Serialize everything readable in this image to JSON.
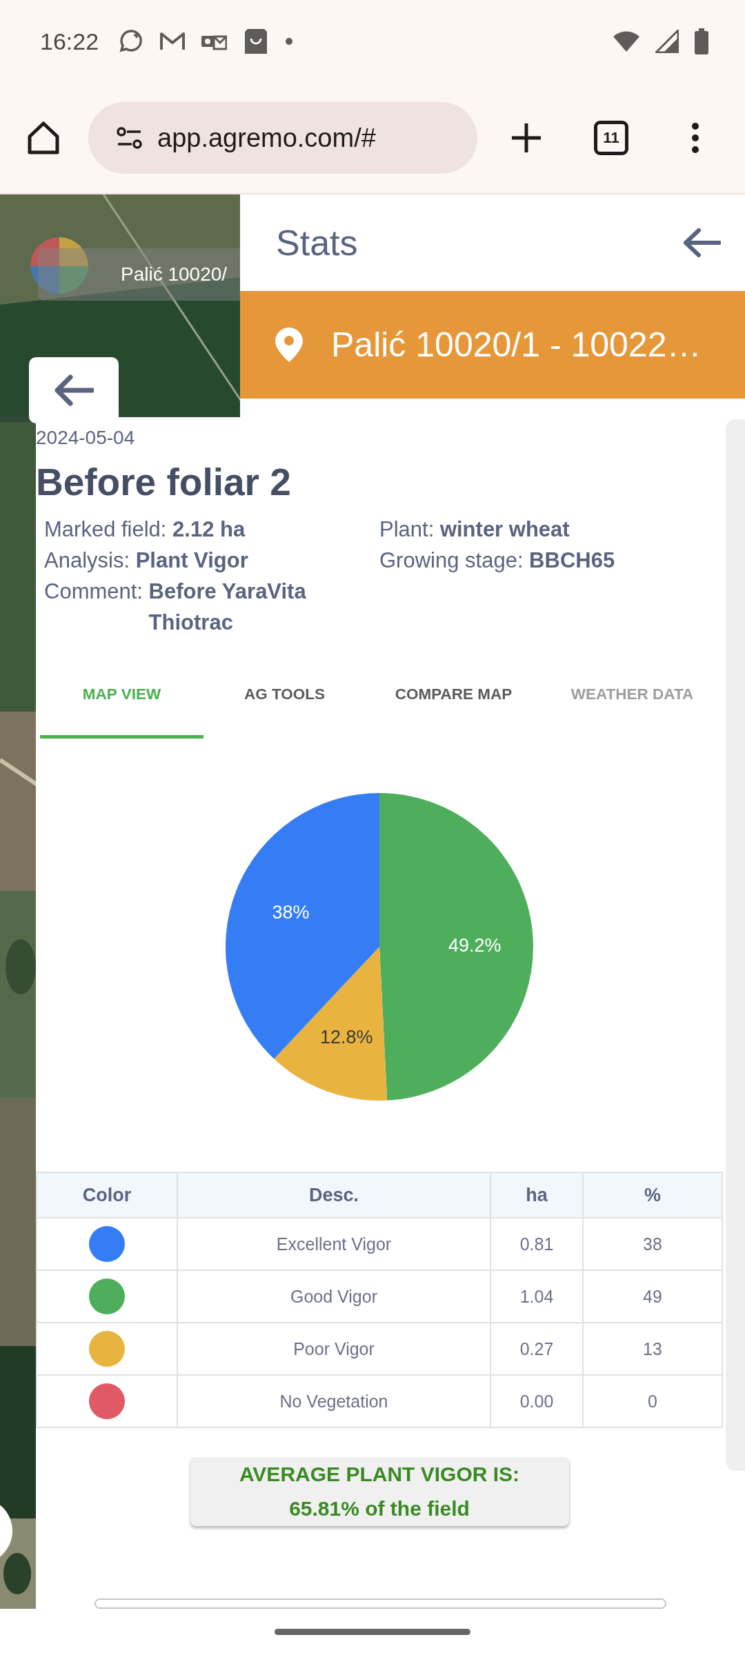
{
  "status_bar": {
    "time": "16:22"
  },
  "browser": {
    "url": "app.agremo.com/#",
    "tab_count": "11"
  },
  "map": {
    "field_label": "Palić 10020/"
  },
  "stats_panel": {
    "title": "Stats",
    "location": "Palić 10020/1 - 10022…"
  },
  "analysis": {
    "date": "2024-05-04",
    "title": "Before foliar 2",
    "details": [
      {
        "label": "Marked field: ",
        "value": "2.12 ha"
      },
      {
        "label": "Plant: ",
        "value": "winter wheat"
      },
      {
        "label": "Analysis: ",
        "value": "Plant Vigor"
      },
      {
        "label": "Growing stage: ",
        "value": "BBCH65"
      },
      {
        "label": "Comment: ",
        "value": "Before YaraVita Thiotrac"
      }
    ]
  },
  "tabs": [
    {
      "label": "MAP VIEW",
      "selected": true,
      "disabled": false
    },
    {
      "label": "AG TOOLS",
      "selected": false,
      "disabled": false
    },
    {
      "label": "COMPARE MAP",
      "selected": false,
      "disabled": false
    },
    {
      "label": "WEATHER DATA",
      "selected": false,
      "disabled": true
    }
  ],
  "chart_data": {
    "type": "pie",
    "values": [
      49.2,
      12.8,
      38
    ],
    "colors": [
      "#4fae5c",
      "#e8b43f",
      "#357df5"
    ],
    "value_labels": [
      "49.2%",
      "12.8%",
      "38%"
    ]
  },
  "table": {
    "columns": [
      "Color",
      "Desc.",
      "ha",
      "%"
    ],
    "rows": [
      {
        "color": "#357df5",
        "desc": "Excellent Vigor",
        "ha": "0.81",
        "percent": "38"
      },
      {
        "color": "#4fae5c",
        "desc": "Good Vigor",
        "ha": "1.04",
        "percent": "49"
      },
      {
        "color": "#e8b43f",
        "desc": "Poor Vigor",
        "ha": "0.27",
        "percent": "13"
      },
      {
        "color": "#e05a66",
        "desc": "No Vegetation",
        "ha": "0.00",
        "percent": "0"
      }
    ]
  },
  "summary": {
    "heading": "AVERAGE PLANT VIGOR IS:",
    "value": "65.81% of the field"
  }
}
